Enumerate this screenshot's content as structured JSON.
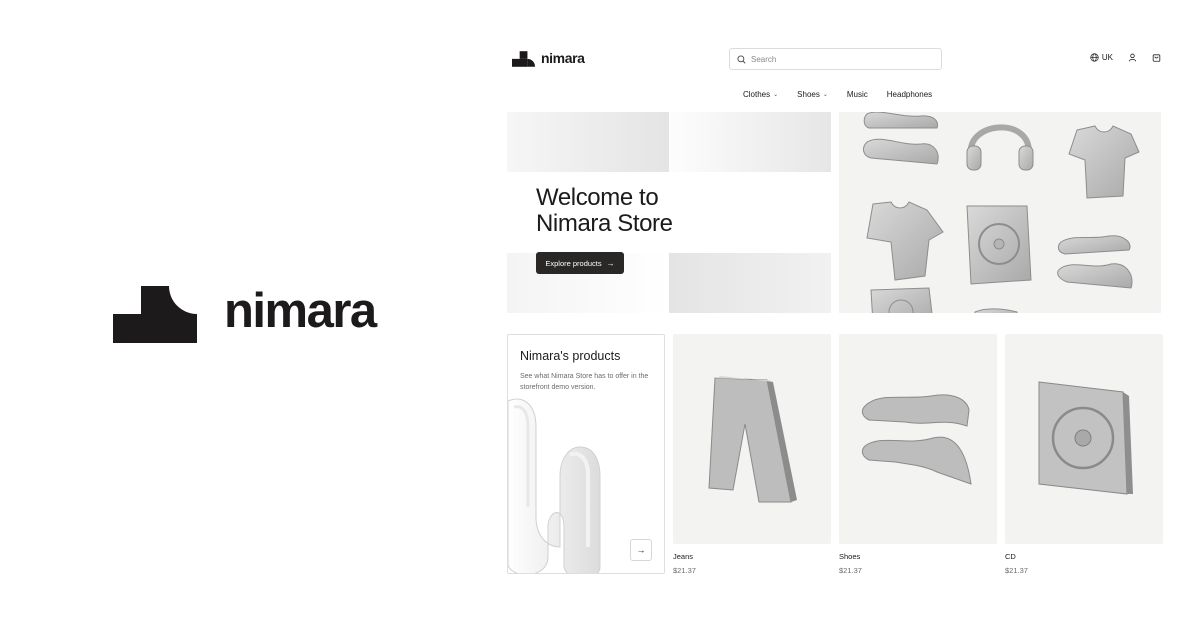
{
  "brand": {
    "name": "nimara",
    "icon": "nimara-logo-icon"
  },
  "header": {
    "logo_text": "nimara",
    "search_placeholder": "Search",
    "locale": "UK",
    "icons": [
      "globe-icon",
      "user-icon",
      "shopping-bag-icon",
      "search-icon"
    ]
  },
  "nav": {
    "items": [
      {
        "label": "Clothes",
        "has_dropdown": true
      },
      {
        "label": "Shoes",
        "has_dropdown": true
      },
      {
        "label": "Music",
        "has_dropdown": false
      },
      {
        "label": "Headphones",
        "has_dropdown": false
      }
    ]
  },
  "hero": {
    "title_line1": "Welcome to",
    "title_line2": "Nimara Store",
    "button_label": "Explore products",
    "button_icon": "arrow-right-icon"
  },
  "promo": {
    "title": "Nimara's products",
    "description": "See what Nimara Store has to offer in the storefront demo version."
  },
  "products": [
    {
      "name": "Jeans",
      "price": "$21.37"
    },
    {
      "name": "Shoes",
      "price": "$21.37"
    },
    {
      "name": "CD",
      "price": "$21.37"
    }
  ],
  "colors": {
    "ink": "#1c1a1a",
    "button": "#2a2727",
    "product_bg": "#f3f3f1",
    "muted_text": "#6b6b6b"
  }
}
